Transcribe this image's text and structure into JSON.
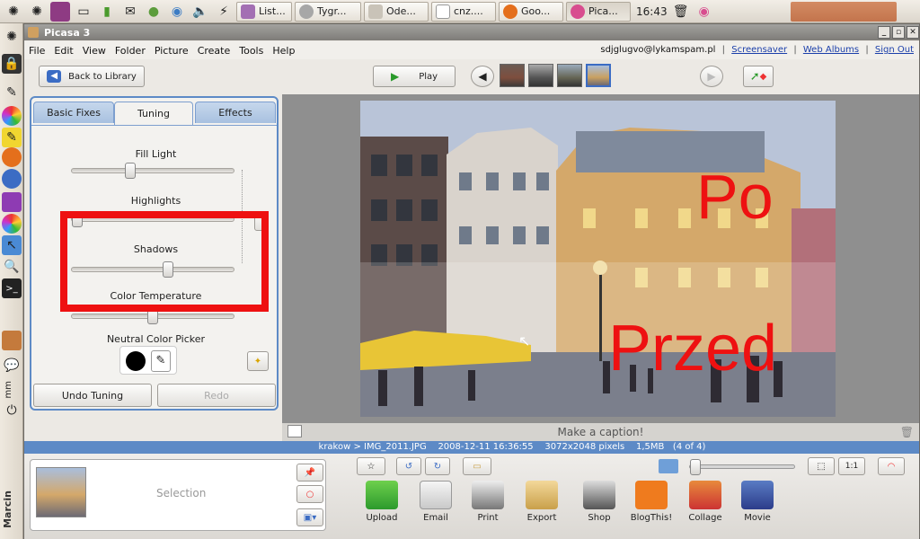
{
  "system_panel": {
    "tasks": [
      {
        "label": "List...",
        "color": "#a36fb3"
      },
      {
        "label": "Tygr...",
        "color": "#a7a7a7"
      },
      {
        "label": "Ode...",
        "color": "#c9c3b8"
      },
      {
        "label": "cnz....",
        "color": "#ffffff"
      },
      {
        "label": "Goo...",
        "color": "#e46f1c"
      },
      {
        "label": "Pica...",
        "color": "#d84d8f"
      }
    ],
    "clock": "16:43"
  },
  "dock": {
    "text_mm": "mm",
    "user": "Marcin"
  },
  "window": {
    "title": "Picasa 3",
    "menu": [
      "File",
      "Edit",
      "View",
      "Folder",
      "Picture",
      "Create",
      "Tools",
      "Help"
    ],
    "account": {
      "email": "sdjglugvo@lykamspam.pl",
      "screensaver": "Screensaver",
      "web_albums": "Web Albums",
      "sign_out": "Sign Out"
    }
  },
  "toolbar": {
    "back_label": "Back to Library",
    "play_label": "Play"
  },
  "tabs": [
    "Basic Fixes",
    "Tuning",
    "Effects"
  ],
  "tuning": {
    "fill_light": {
      "label": "Fill Light",
      "value": 0.35
    },
    "highlights": {
      "label": "Highlights",
      "value": 0.0
    },
    "shadows": {
      "label": "Shadows",
      "value": 0.6
    },
    "color_temperature": {
      "label": "Color Temperature",
      "value": 0.5
    },
    "neutral_color_picker": "Neutral Color Picker",
    "undo_label": "Undo Tuning",
    "redo_label": "Redo"
  },
  "photo": {
    "overlay_after": "Po",
    "overlay_before": "Przed"
  },
  "caption_placeholder": "Make a caption!",
  "info": {
    "path": "krakow > IMG_2011.JPG",
    "datetime": "2008-12-11 16:36:55",
    "dimensions": "3072x2048 pixels",
    "size": "1,5MB",
    "position": "(4 of 4)"
  },
  "bottom": {
    "selection_label": "Selection",
    "actions": [
      "Upload",
      "Email",
      "Print",
      "Export",
      "Shop",
      "BlogThis!",
      "Collage",
      "Movie"
    ]
  },
  "colors": {
    "accent_blue": "#5d8ac6",
    "highlight_red": "#ee1111"
  }
}
